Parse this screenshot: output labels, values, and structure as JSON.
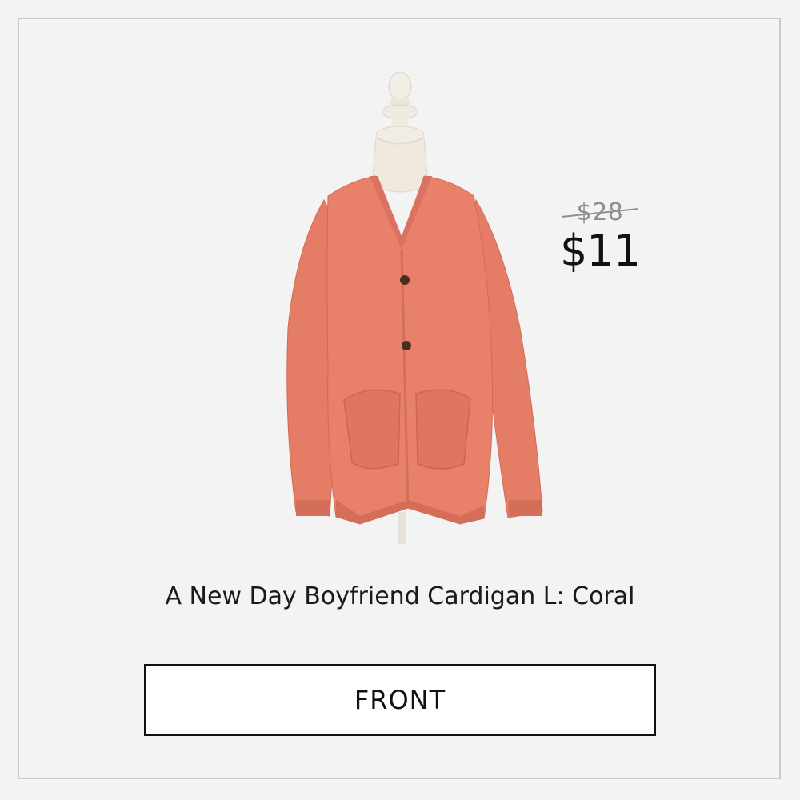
{
  "listing": {
    "original_price": "$28",
    "sale_price": "$11",
    "title": "A New Day Boyfriend Cardigan L: Coral",
    "view_label": "FRONT"
  },
  "product_image": {
    "subject": "coral-cardigan-on-mannequin",
    "garment_color": "#e8806a"
  }
}
